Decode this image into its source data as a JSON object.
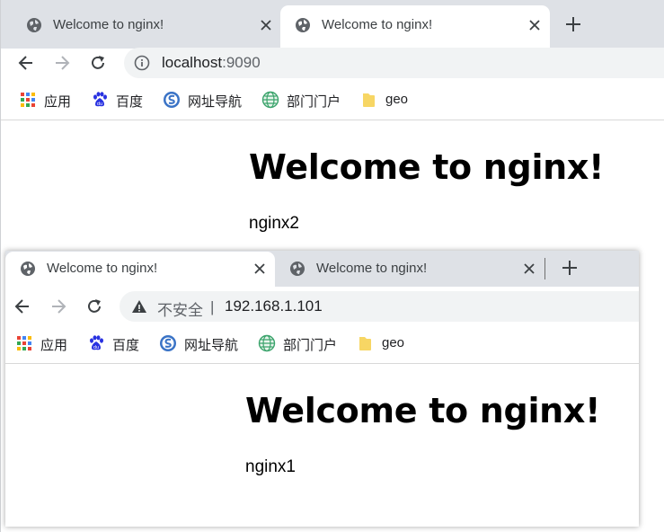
{
  "back_window": {
    "tabs": [
      {
        "title": "Welcome to nginx!",
        "active": false
      },
      {
        "title": "Welcome to nginx!",
        "active": true
      }
    ],
    "omnibox": {
      "host": "localhost",
      "port": ":9090",
      "security_icon": "info-icon"
    },
    "bookmarks": [
      {
        "label": "应用",
        "icon": "apps-grid-icon"
      },
      {
        "label": "百度",
        "icon": "baidu-paw-icon"
      },
      {
        "label": "网址导航",
        "icon": "sogou-icon"
      },
      {
        "label": "部门门户",
        "icon": "globe-icon"
      },
      {
        "label": "geo",
        "icon": "folder-icon"
      }
    ],
    "page": {
      "heading": "Welcome to nginx!",
      "text": "nginx2"
    }
  },
  "front_window": {
    "tabs": [
      {
        "title": "Welcome to nginx!",
        "active": true
      },
      {
        "title": "Welcome to nginx!",
        "active": false
      }
    ],
    "omnibox": {
      "insecure_label": "不安全",
      "separator": "|",
      "url": "192.168.1.101",
      "security_icon": "warning-icon"
    },
    "bookmarks": [
      {
        "label": "应用",
        "icon": "apps-grid-icon"
      },
      {
        "label": "百度",
        "icon": "baidu-paw-icon"
      },
      {
        "label": "网址导航",
        "icon": "sogou-icon"
      },
      {
        "label": "部门门户",
        "icon": "globe-icon"
      },
      {
        "label": "geo",
        "icon": "folder-icon"
      }
    ],
    "page": {
      "heading": "Welcome to nginx!",
      "text": "nginx1"
    }
  },
  "colors": {
    "tabstrip": "#dee1e6",
    "omnibox": "#f1f3f4",
    "icon_gray": "#5f6368",
    "folder": "#f7d664"
  }
}
